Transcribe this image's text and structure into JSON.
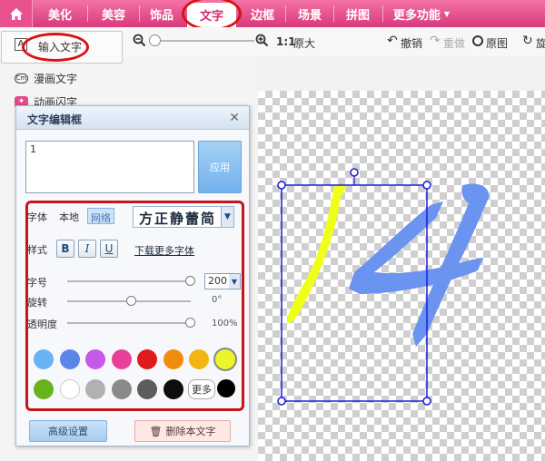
{
  "nav": {
    "tabs": [
      {
        "label": "美化"
      },
      {
        "label": "美容"
      },
      {
        "label": "饰品"
      },
      {
        "label": "文字"
      },
      {
        "label": "边框"
      },
      {
        "label": "场景"
      },
      {
        "label": "拼图"
      },
      {
        "label": "更多功能"
      }
    ],
    "active_tab": "文字",
    "icons": {
      "home": "home-icon",
      "more": "chevron-down-icon"
    }
  },
  "toolbar": {
    "zoom_value": "1:1",
    "original_size": "原大",
    "undo": "撤销",
    "redo": "重做",
    "original_image": "原图",
    "rotate_partial": "旋"
  },
  "side": {
    "input_text": "输入文字",
    "comic_text": "漫画文字",
    "animated_text": "动画闪字"
  },
  "dialog": {
    "title": "文字编辑框",
    "text_value": "1",
    "apply": "应用",
    "font_label": "字体",
    "local": "本地",
    "network": "网络",
    "font_sample": "方正静蕾简",
    "style_label": "样式",
    "bold": "B",
    "italic": "I",
    "underline": "U",
    "download_fonts": "下载更多字体",
    "size_label": "字号",
    "size_value": "200",
    "rotate_label": "旋转",
    "rotate_value": "0°",
    "opacity_label": "透明度",
    "opacity_value": "100%",
    "more_label": "更多",
    "advanced": "高级设置",
    "delete_text": "删除本文字"
  },
  "colors": {
    "accent_pink": "#e0407f",
    "swatches_row1": [
      "#6ab3f2",
      "#5b86e8",
      "#c559e8",
      "#e8409a",
      "#e01b1b",
      "#f28c0e",
      "#f4b511",
      "#ebf52a"
    ],
    "swatches_row2": [
      "#67b31b",
      "#ffffff",
      "#b1b1b1",
      "#8a8a8a",
      "#5c5c5c",
      "#0e0e0e"
    ],
    "more_swatch": "#000000",
    "selected_swatch": "#ebf52a",
    "canvas_text_colors": [
      "#f0ff1a",
      "#6b93f0"
    ]
  }
}
